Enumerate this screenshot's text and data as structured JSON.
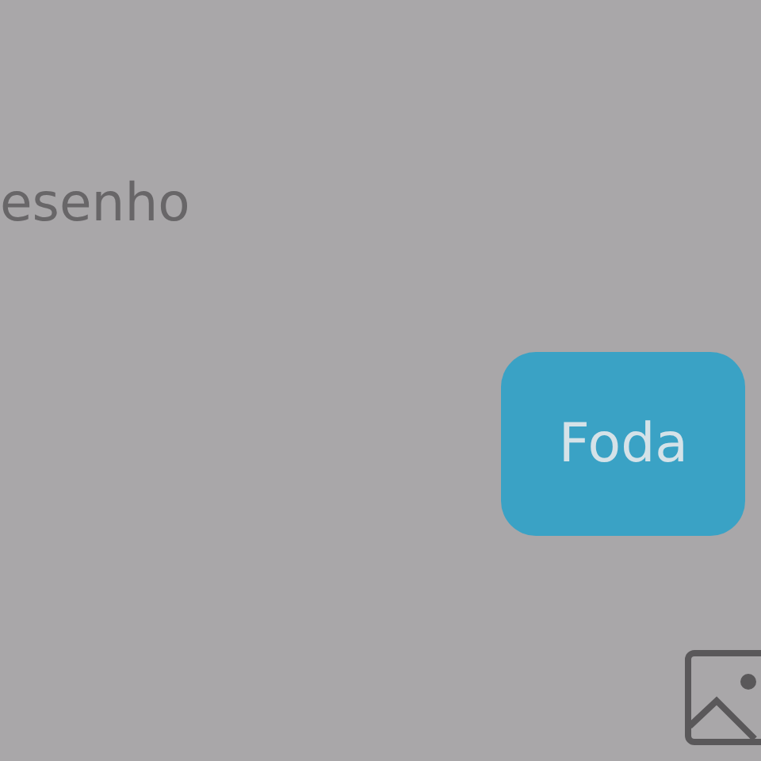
{
  "messages": [
    {
      "text": "esenho",
      "kind": "received"
    },
    {
      "text": "Foda",
      "kind": "sent"
    }
  ]
}
